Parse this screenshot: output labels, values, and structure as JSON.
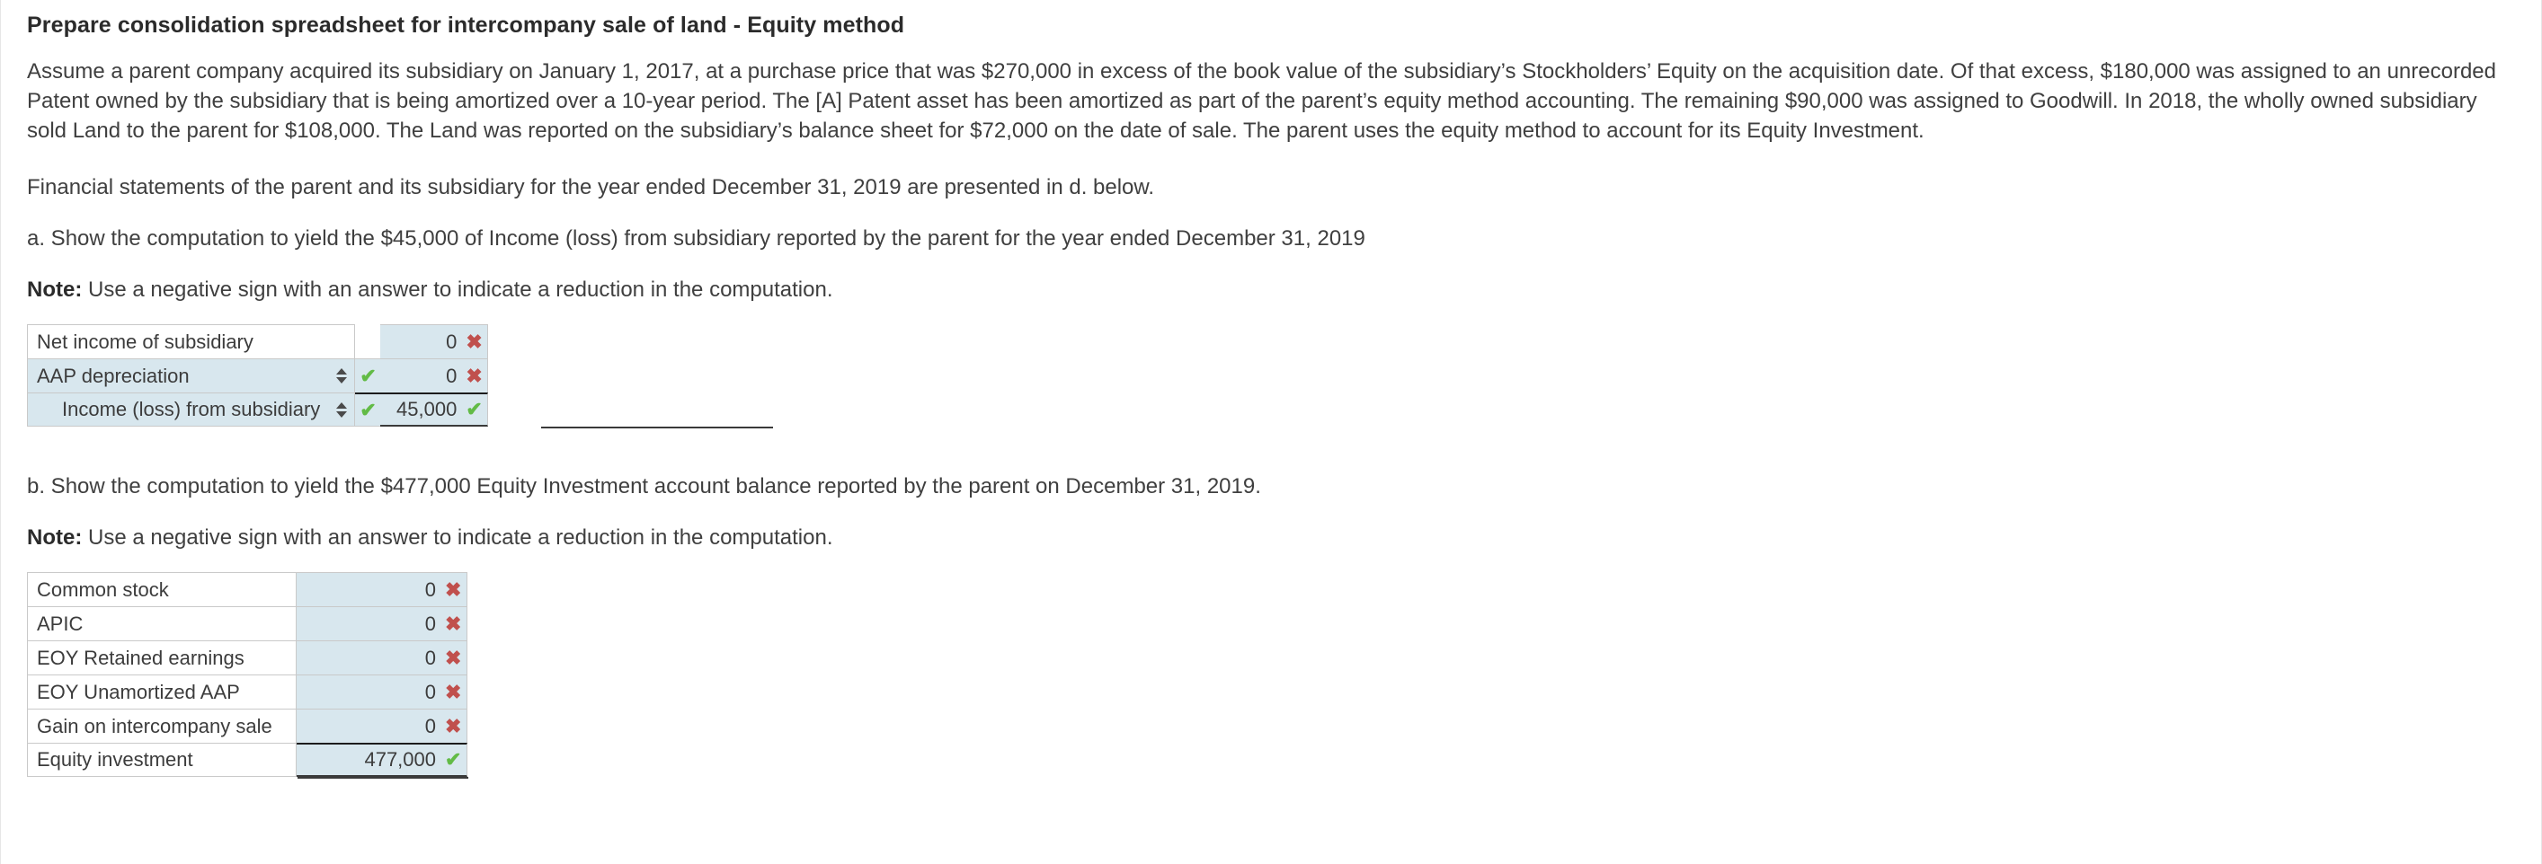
{
  "title": "Prepare consolidation spreadsheet for intercompany sale of land - Equity method",
  "intro": "Assume a parent company acquired its subsidiary on January 1, 2017, at a purchase price that was $270,000 in excess of the book value of the subsidiary’s Stockholders’ Equity on the acquisition date. Of that excess, $180,000 was assigned to an unrecorded Patent owned by the subsidiary that is being amortized over a 10-year period. The [A] Patent asset has been amortized as part of the parent’s equity method accounting. The remaining $90,000 was assigned to Goodwill. In 2018, the wholly owned subsidiary sold Land to the parent for $108,000. The Land was reported on the subsidiary’s balance sheet for $72,000 on the date of sale. The parent uses the equity method to account for its Equity Investment.",
  "statements_line": "Financial statements of the parent and its subsidiary for the year ended December 31, 2019 are presented in d. below.",
  "part_a": {
    "prompt": "a. Show the computation to yield the $45,000 of Income (loss) from subsidiary reported by the parent for the year ended December 31, 2019",
    "note_label": "Note:",
    "note_text": " Use a negative sign with an answer to indicate a reduction in the computation.",
    "rows": [
      {
        "label": "Net income of subsidiary",
        "has_select": false,
        "label_shaded": false,
        "indent": false,
        "mid_mark": "",
        "value": "0",
        "value_mark": "wrong",
        "is_total": false
      },
      {
        "label": "AAP depreciation",
        "has_select": true,
        "label_shaded": true,
        "indent": false,
        "mid_mark": "right",
        "value": "0",
        "value_mark": "wrong",
        "is_total": false
      },
      {
        "label": "Income (loss) from subsidiary",
        "has_select": true,
        "label_shaded": true,
        "indent": true,
        "mid_mark": "right",
        "value": "45,000",
        "value_mark": "right",
        "is_total": true
      }
    ]
  },
  "part_b": {
    "prompt": "b. Show the computation to yield the $477,000 Equity Investment account balance reported by the parent on December 31, 2019.",
    "note_label": "Note:",
    "note_text": " Use a negative sign with an answer to indicate a reduction in the computation.",
    "rows": [
      {
        "label": "Common stock",
        "value": "0",
        "value_mark": "wrong",
        "is_total": false
      },
      {
        "label": "APIC",
        "value": "0",
        "value_mark": "wrong",
        "is_total": false
      },
      {
        "label": "EOY Retained earnings",
        "value": "0",
        "value_mark": "wrong",
        "is_total": false
      },
      {
        "label": "EOY Unamortized AAP",
        "value": "0",
        "value_mark": "wrong",
        "is_total": false
      },
      {
        "label": "Gain on intercompany sale",
        "value": "0",
        "value_mark": "wrong",
        "is_total": false
      },
      {
        "label": "Equity investment",
        "value": "477,000",
        "value_mark": "right",
        "is_total": true
      }
    ]
  },
  "icons": {
    "wrong": "✖",
    "right": "✔",
    "select": "select-updown-arrows"
  },
  "colors": {
    "cell_fill": "#d8e7ee",
    "cell_border": "#c9c9c9",
    "mark_wrong": "#c0504d",
    "mark_right": "#62bb46",
    "text": "#3f3f3f"
  }
}
